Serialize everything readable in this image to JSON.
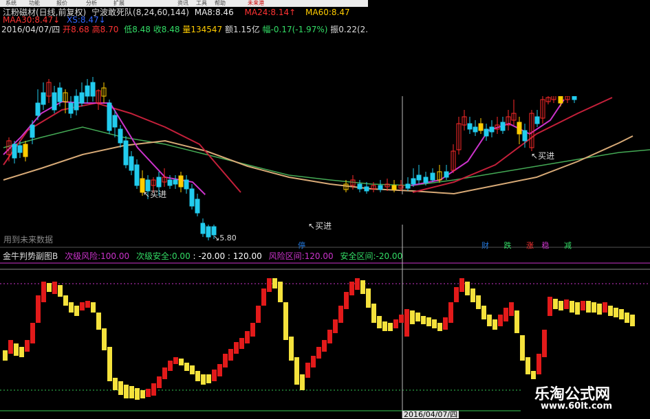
{
  "menu": {
    "items": [
      "系统",
      "功能",
      "报价",
      "分析",
      "扩展",
      "资讯",
      "工具",
      "帮助"
    ],
    "highlight_label": "未来港"
  },
  "header": {
    "stock_name": "江粉磁材(日线,前复权)",
    "indicator_name": "宁波敢死队(8,24,60,144)",
    "ma8_label": "MA8:",
    "ma8_value": "8.46",
    "ma24_label": "MA24:",
    "ma24_value": "8.14↑",
    "ma60_label": "MA60:",
    "ma60_value": "8.47",
    "maa30_label": "MAA30:",
    "maa30_value": "8.47↓",
    "xs_label": "XS:",
    "xs_value": "8.47↓",
    "date": "2016/04/07/四",
    "open_label": "开",
    "open_value": "8.68",
    "high_label": "高",
    "high_value": "8.70",
    "low_label": "低",
    "low_value": "8.48",
    "close_label": "收",
    "close_value": "8.48",
    "volume_label": "量",
    "volume_value": "134547",
    "amount_label": "额",
    "amount_value": "1.15亿",
    "change_label": "幅",
    "change_value": "-0.17(-1.97%)",
    "amplitude_label": "振",
    "amplitude_value": "0.22(2."
  },
  "annotations": {
    "buy1": "买进",
    "buy2": "买进",
    "buy3": "买进",
    "low_price": "5.80",
    "future_note": "用到未来数据",
    "wait_label": "停",
    "signals": [
      "财",
      "跌",
      "涨",
      "稳",
      "减"
    ]
  },
  "sub_chart": {
    "title": "金牛判势副图B",
    "risk_label": "次级风险:",
    "risk_value": "100.00",
    "safe_label": "次级安全:",
    "safe_value": "0.00",
    "safe_extra": ": -20.00",
    "safe_extra2": ": 120.00",
    "riskzone_label": "风险区间:",
    "riskzone_value": "120.00",
    "safezone_label": "安全区间:",
    "safezone_value": "-20.00"
  },
  "bottom": {
    "date_label": "2016/04/07/四"
  },
  "watermark": {
    "title": "乐淘公式网",
    "url": "www.60lt.com"
  },
  "colors": {
    "up": "#ff2a2a",
    "down": "#22ccee",
    "hollow_up": "#ffcc00",
    "ma_fast": "#cc33cc",
    "ma_red": "#c4203a",
    "ma_green": "#44aa55",
    "ma_tan": "#d8aa77",
    "osc_red": "#e21a1a",
    "osc_yellow": "#f5e23c",
    "risk_line": "#cc33cc",
    "safe_line": "#33cc55"
  },
  "chart_data": [
    {
      "type": "candlestick",
      "title": "江粉磁材(日线,前复权)",
      "series": [
        {
          "name": "MA8",
          "last": 8.46
        },
        {
          "name": "MA24",
          "last": 8.14
        },
        {
          "name": "MA60",
          "last": 8.47
        },
        {
          "name": "MAA30",
          "last": 8.47
        },
        {
          "name": "XS",
          "last": 8.47
        }
      ],
      "last_bar": {
        "date": "2016/04/07",
        "open": 8.68,
        "high": 8.7,
        "low": 8.48,
        "close": 8.48
      },
      "visible_low": 5.8
    },
    {
      "type": "bar",
      "title": "金牛判势副图B",
      "series": [
        {
          "name": "次级风险",
          "values": [
            100.0
          ]
        },
        {
          "name": "次级安全",
          "values": [
            0.0
          ]
        },
        {
          "name": "风险区间",
          "values": [
            120.0
          ]
        },
        {
          "name": "安全区间",
          "values": [
            -20.0
          ]
        }
      ],
      "ylim": [
        -20,
        120
      ]
    }
  ]
}
